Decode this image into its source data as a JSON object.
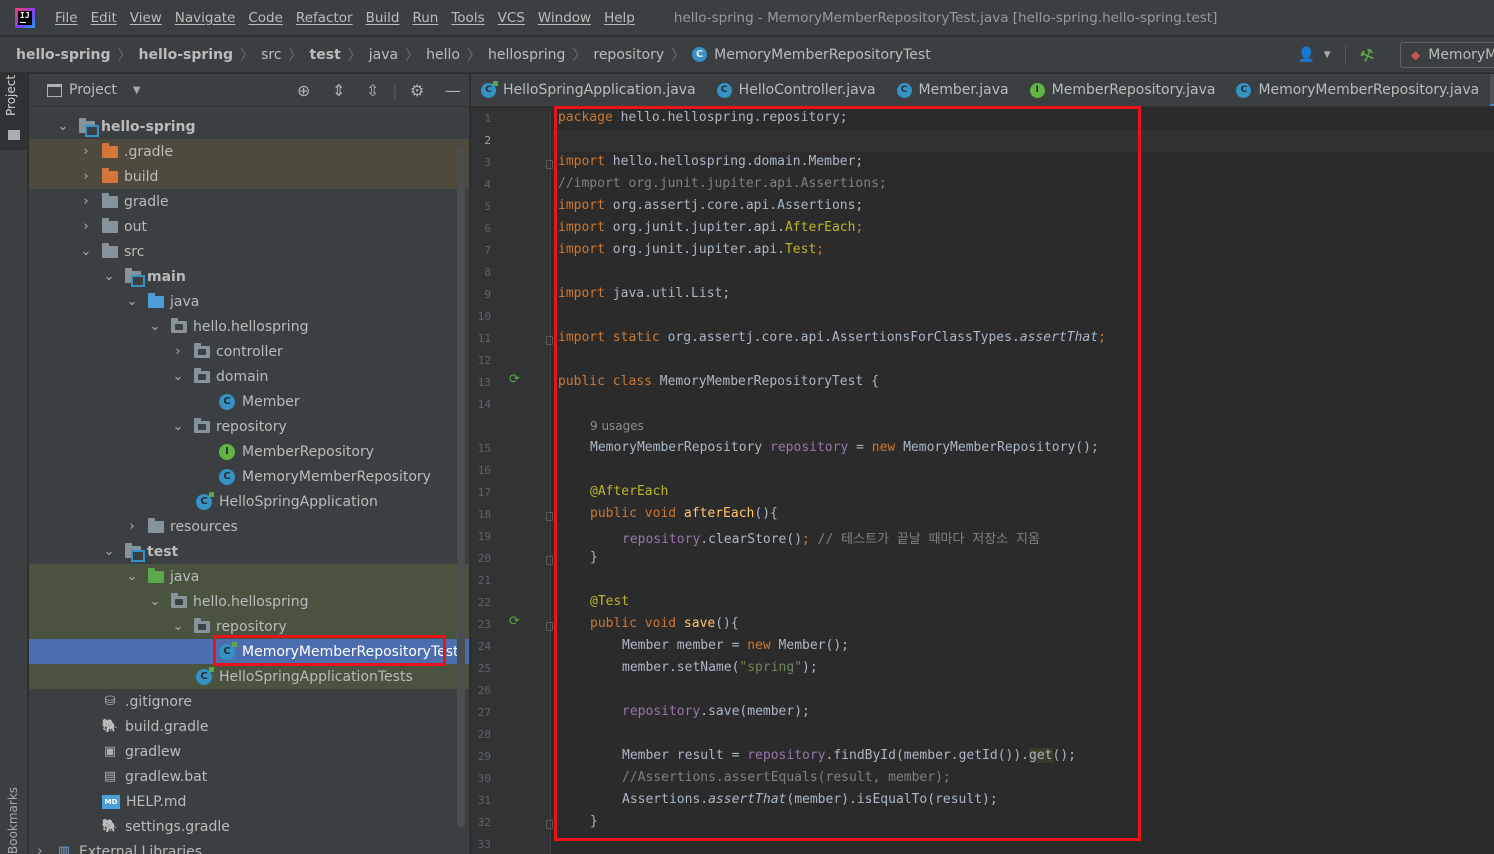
{
  "menu": [
    "File",
    "Edit",
    "View",
    "Navigate",
    "Code",
    "Refactor",
    "Build",
    "Run",
    "Tools",
    "VCS",
    "Window",
    "Help"
  ],
  "window_title": "hello-spring - MemoryMemberRepositoryTest.java [hello-spring.hello-spring.test]",
  "breadcrumb": [
    "hello-spring",
    "hello-spring",
    "src",
    "test",
    "java",
    "hello",
    "hellospring",
    "repository",
    "MemoryMemberRepositoryTest"
  ],
  "run_config": "MemoryM",
  "tool_strip": {
    "project": "Project",
    "bookmarks": "Bookmarks"
  },
  "project_panel": {
    "title": "Project"
  },
  "tree": [
    {
      "label": "hello-spring",
      "bold": true
    },
    {
      "label": ".gradle"
    },
    {
      "label": "build"
    },
    {
      "label": "gradle"
    },
    {
      "label": "out"
    },
    {
      "label": "src"
    },
    {
      "label": "main",
      "bold": true
    },
    {
      "label": "java"
    },
    {
      "label": "hello.hellospring"
    },
    {
      "label": "controller"
    },
    {
      "label": "domain"
    },
    {
      "label": "Member"
    },
    {
      "label": "repository"
    },
    {
      "label": "MemberRepository"
    },
    {
      "label": "MemoryMemberRepository"
    },
    {
      "label": "HelloSpringApplication"
    },
    {
      "label": "resources"
    },
    {
      "label": "test",
      "bold": true
    },
    {
      "label": "java"
    },
    {
      "label": "hello.hellospring"
    },
    {
      "label": "repository"
    },
    {
      "label": "MemoryMemberRepositoryTest"
    },
    {
      "label": "HelloSpringApplicationTests"
    },
    {
      "label": ".gitignore"
    },
    {
      "label": "build.gradle"
    },
    {
      "label": "gradlew"
    },
    {
      "label": "gradlew.bat"
    },
    {
      "label": "HELP.md"
    },
    {
      "label": "settings.gradle"
    },
    {
      "label": "External Libraries"
    }
  ],
  "tabs": [
    "HelloSpringApplication.java",
    "HelloController.java",
    "Member.java",
    "MemberRepository.java",
    "MemoryMemberRepository.java"
  ],
  "code": {
    "usages_hint": "9 usages",
    "line_numbers": [
      "1",
      "2",
      "3",
      "4",
      "5",
      "6",
      "7",
      "8",
      "9",
      "10",
      "11",
      "12",
      "13",
      "14",
      "15",
      "16",
      "17",
      "18",
      "19",
      "20",
      "21",
      "22",
      "23",
      "24",
      "25",
      "26",
      "27",
      "28",
      "29",
      "30",
      "31",
      "32",
      "33"
    ],
    "l1_kw": "package",
    "l1_rest": " hello.hellospring.repository;",
    "l3_kw": "import",
    "l3_rest": " hello.hellospring.domain.Member;",
    "l4": "//import org.junit.jupiter.api.Assertions;",
    "l5_kw": "import",
    "l5_rest": " org.assertj.core.api.Assertions;",
    "l6_kw": "import",
    "l6_pre": " org.junit.jupiter.api.",
    "l6_ann": "AfterEach",
    "l6_end": ";",
    "l7_kw": "import",
    "l7_pre": " org.junit.jupiter.api.",
    "l7_ann": "Test",
    "l7_end": ";",
    "l9_kw": "import",
    "l9_rest": " java.util.List;",
    "l11_kw": "import static",
    "l11_pre": " org.assertj.core.api.AssertionsForClassTypes.",
    "l11_it": "assertThat",
    "l11_end": ";",
    "l13_kw": "public class",
    "l13_rest": " MemoryMemberRepositoryTest {",
    "l15_a": "MemoryMemberRepository ",
    "l15_fld": "repository",
    "l15_b": " = ",
    "l15_kw": "new",
    "l15_c": " MemoryMemberRepository();",
    "l17": "@AfterEach",
    "l18_kw": "public void",
    "l18_m": " afterEach",
    "l18_end": "(){",
    "l19_fld": "repository",
    "l19_a": ".clearStore()",
    "l19_kw": ";",
    "l19_cmt": " // 테스트가 끝날 때마다 저장소 지움",
    "l20": "}",
    "l22": "@Test",
    "l23_kw": "public void",
    "l23_m": " save",
    "l23_end": "(){",
    "l24_a": "Member member = ",
    "l24_kw": "new",
    "l24_b": " Member();",
    "l25_a": "member.setName(",
    "l25_str": "\"spring\"",
    "l25_b": ");",
    "l27_fld": "repository",
    "l27_a": ".save(member);",
    "l29_a": "Member result = ",
    "l29_fld": "repository",
    "l29_b": ".findById(member.getId()).",
    "l29_hl": "get",
    "l29_c": "();",
    "l30": "//Assertions.assertEquals(result, member);",
    "l31_a": "Assertions.",
    "l31_it": "assertThat",
    "l31_b": "(member).isEqualTo(result);",
    "l32": "}"
  },
  "colors": {
    "accent": "#4a88c7",
    "annotation_box": "#e8141b",
    "selection": "#4b6eaf"
  }
}
